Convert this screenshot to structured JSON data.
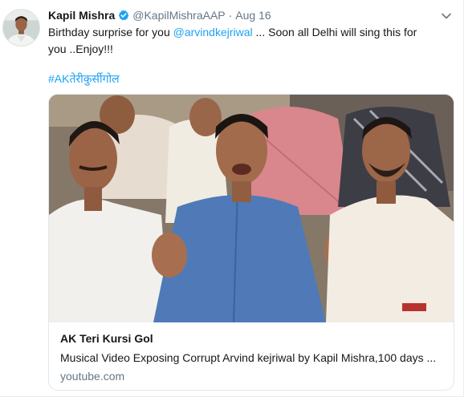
{
  "tweet": {
    "display_name": "Kapil Mishra",
    "handle": "@KapilMishraAAP",
    "separator": "·",
    "timestamp": "Aug 16",
    "text_before": "Birthday surprise for you ",
    "mention": "@arvindkejriwal",
    "text_after": " ... Soon all Delhi will sing this for you ..Enjoy!!!",
    "hashtag": "#AKतेरीकुर्सीगोल"
  },
  "card": {
    "title": "AK Teri Kursi Gol",
    "description": "Musical Video Exposing Corrupt Arvind kejriwal by Kapil Mishra,100 days ...",
    "domain": "youtube.com"
  },
  "icons": {
    "verified": "verified-badge-icon",
    "more": "chevron-down-icon"
  },
  "colors": {
    "link": "#1da1f2",
    "secondary_text": "#657786",
    "border": "#e1e8ed"
  }
}
